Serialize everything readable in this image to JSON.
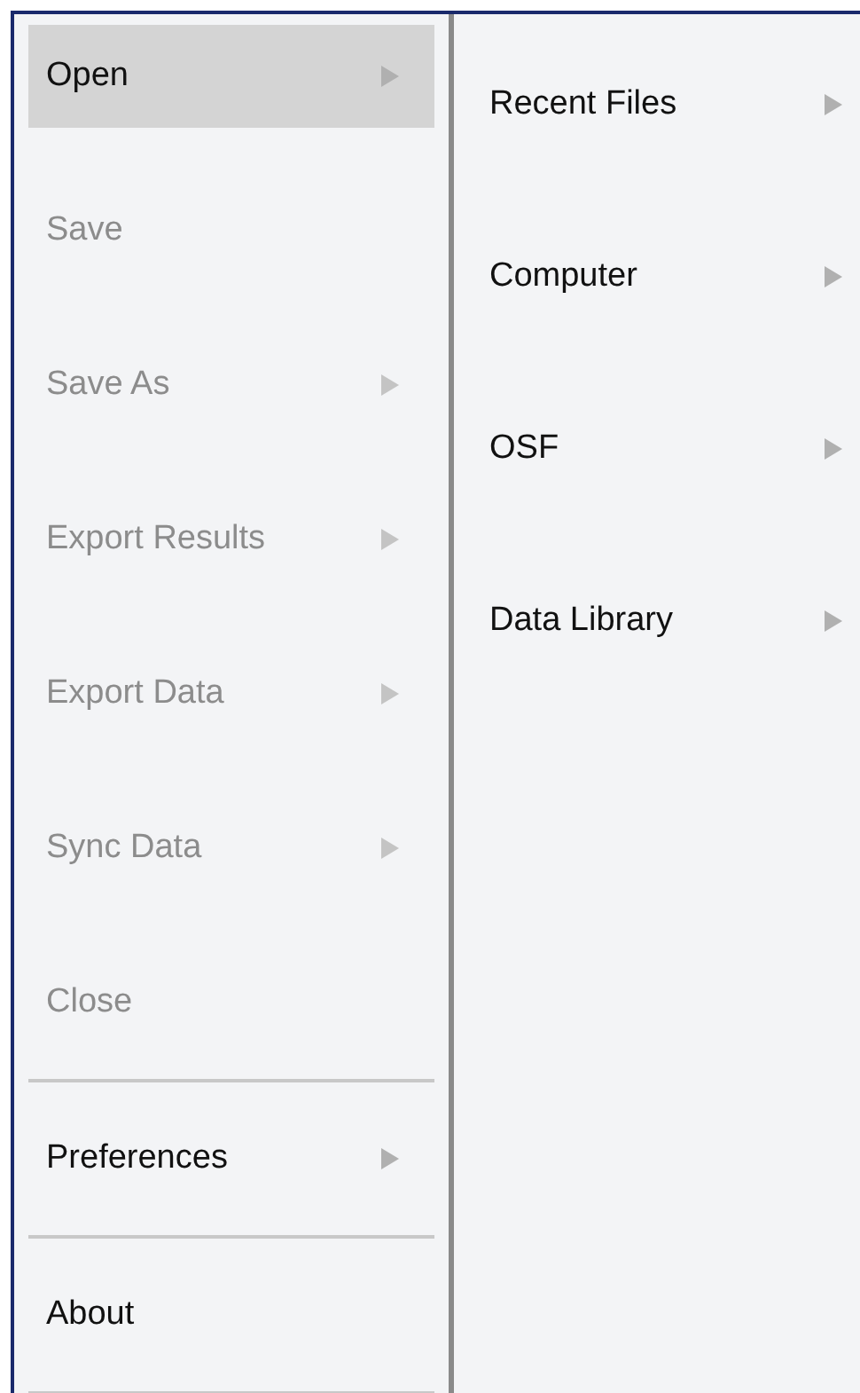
{
  "file_menu": [
    {
      "kind": "item",
      "label": "Open",
      "selected": true,
      "disabled": false,
      "submenu": true
    },
    {
      "kind": "item",
      "label": "Save",
      "selected": false,
      "disabled": true,
      "submenu": false
    },
    {
      "kind": "item",
      "label": "Save As",
      "selected": false,
      "disabled": true,
      "submenu": true
    },
    {
      "kind": "item",
      "label": "Export Results",
      "selected": false,
      "disabled": true,
      "submenu": true
    },
    {
      "kind": "item",
      "label": "Export Data",
      "selected": false,
      "disabled": true,
      "submenu": true
    },
    {
      "kind": "item",
      "label": "Sync Data",
      "selected": false,
      "disabled": true,
      "submenu": true
    },
    {
      "kind": "item",
      "label": "Close",
      "selected": false,
      "disabled": true,
      "submenu": false
    },
    {
      "kind": "separator"
    },
    {
      "kind": "item",
      "label": "Preferences",
      "selected": false,
      "disabled": false,
      "submenu": true
    },
    {
      "kind": "separator"
    },
    {
      "kind": "item",
      "label": "About",
      "selected": false,
      "disabled": false,
      "submenu": false
    },
    {
      "kind": "separator"
    }
  ],
  "open_submenu": [
    {
      "label": "Recent Files",
      "submenu": true
    },
    {
      "label": "Computer",
      "submenu": true
    },
    {
      "label": "OSF",
      "submenu": true
    },
    {
      "label": "Data Library",
      "submenu": true
    }
  ]
}
